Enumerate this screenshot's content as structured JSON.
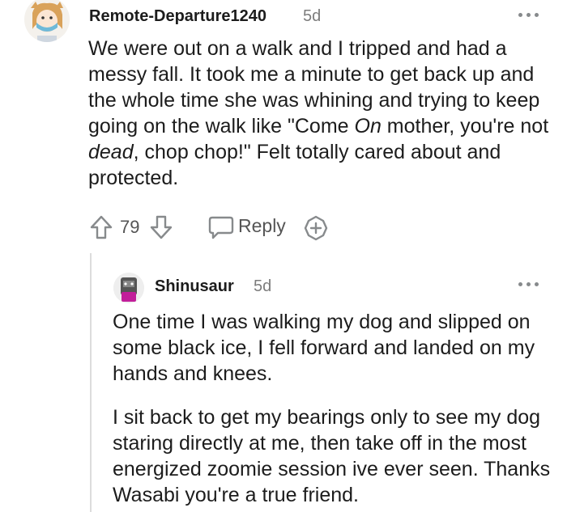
{
  "comment": {
    "username": "Remote-Departure1240",
    "age": "5d",
    "body": "We were out on a walk and I tripped and had a messy fall. It took me a minute to get back up and the whole time she was whining and trying to keep going on the walk like \"Come On mother, you're not dead, chop chop!\" Felt totally cared about and protected.",
    "body_parts": {
      "before_on": "We were out on a walk and I tripped and had a messy fall. It took me a minute to get back up and the whole time she was whining and trying to keep going on the walk like \"Come ",
      "on": "On",
      "between": " mother, you're not ",
      "dead": "dead",
      "after": ", chop chop!\" Felt totally cared about and protected."
    },
    "votes": "79",
    "reply_label": "Reply",
    "icons": [
      "upvote-icon",
      "downvote-icon",
      "reply-icon",
      "award-icon",
      "more-options-icon"
    ]
  },
  "reply": {
    "username": "Shinusaur",
    "age": "5d",
    "paragraphs": [
      "One time I was walking my dog and slipped on some black ice, I fell forward and landed on my hands and knees.",
      "I sit back to get my bearings only to see my dog staring directly at me, then take off in the most energized zoomie session ive ever seen. Thanks Wasabi you're a true friend."
    ]
  },
  "colors": {
    "text": "#1c1c1c",
    "meta": "#7c7c7c",
    "icon": "#878a8c",
    "thread_line": "#dcdcdc"
  }
}
